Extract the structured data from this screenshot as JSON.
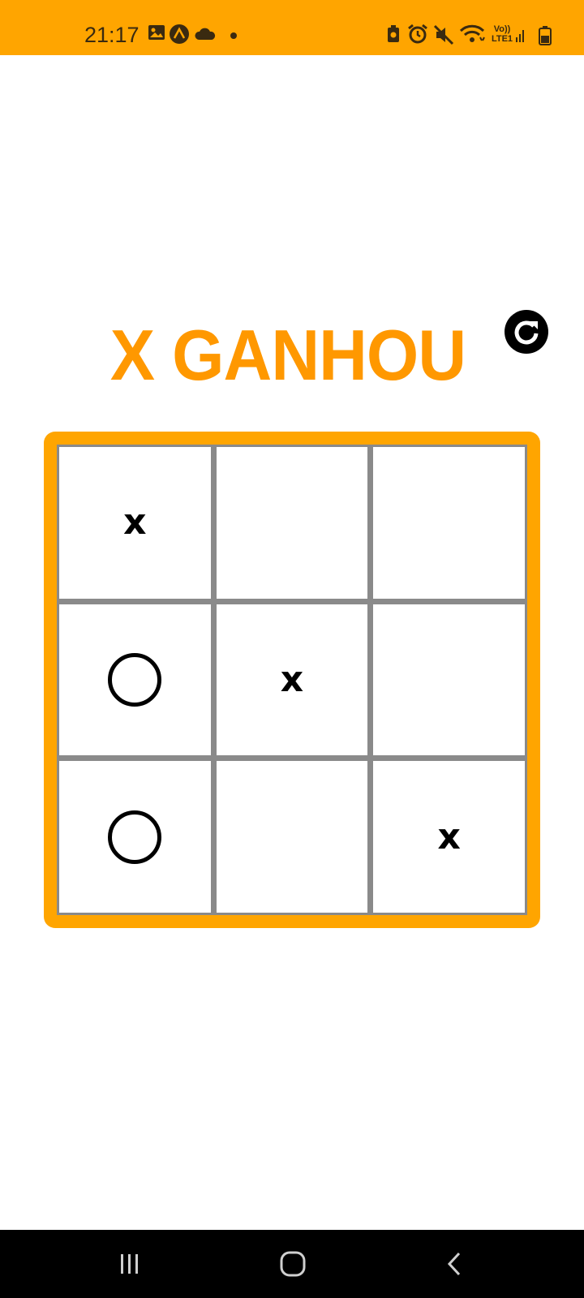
{
  "status_bar": {
    "time": "21:17",
    "left_icons": [
      "gallery-icon",
      "expo-icon",
      "cloud-icon",
      "dot-icon"
    ],
    "right_icons": [
      "battery-saver-icon",
      "alarm-icon",
      "mute-icon",
      "wifi-icon",
      "signal-icon",
      "battery-icon"
    ],
    "network_label_top": "Vo))",
    "network_label_bottom": "LTE1",
    "background_color": "#FFA500"
  },
  "game": {
    "status_text": "X GANHOU",
    "status_color": "#FF9800",
    "reset_icon": "refresh-icon",
    "board_color": "#FFA500",
    "grid_line_color": "#8a8a8a",
    "cells": [
      [
        "x",
        "",
        ""
      ],
      [
        "O",
        "x",
        ""
      ],
      [
        "O",
        "",
        "x"
      ]
    ]
  },
  "nav_bar": {
    "buttons": [
      "recent-apps-icon",
      "home-icon",
      "back-icon"
    ]
  }
}
